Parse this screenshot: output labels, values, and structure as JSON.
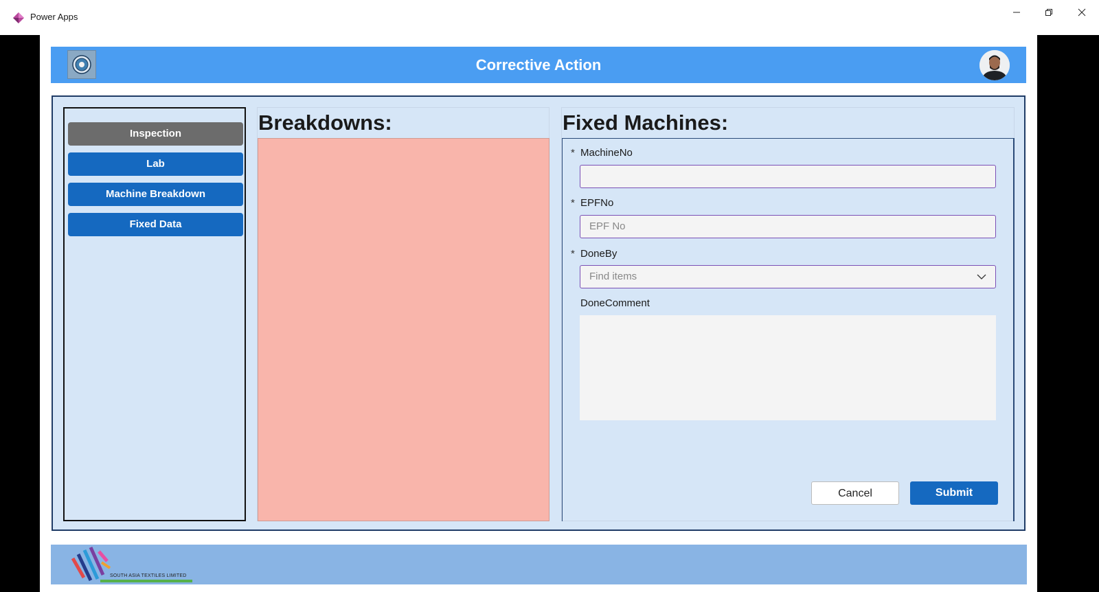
{
  "window": {
    "title": "Power Apps",
    "minimize_icon": "minimize-icon",
    "restore_icon": "restore-icon",
    "close_icon": "close-icon"
  },
  "header": {
    "title": "Corrective Action",
    "logo_icon": "company-seal-icon",
    "avatar_icon": "user-avatar"
  },
  "sidebar": {
    "items": [
      {
        "label": "Inspection",
        "active": true
      },
      {
        "label": "Lab",
        "active": false
      },
      {
        "label": "Machine Breakdown",
        "active": false
      },
      {
        "label": "Fixed Data",
        "active": false
      }
    ]
  },
  "breakdowns": {
    "title": "Breakdowns:"
  },
  "fixed_machines": {
    "title": "Fixed Machines:",
    "fields": {
      "machine_no": {
        "label": "MachineNo",
        "required": "*",
        "value": "",
        "placeholder": ""
      },
      "epf_no": {
        "label": "EPFNo",
        "required": "*",
        "value": "",
        "placeholder": "EPF No"
      },
      "done_by": {
        "label": "DoneBy",
        "required": "*",
        "placeholder": "Find items"
      },
      "done_comment": {
        "label": "DoneComment",
        "value": ""
      }
    },
    "cancel_label": "Cancel",
    "submit_label": "Submit"
  },
  "footer": {
    "company": "SOUTH ASIA TEXTILES LIMITED"
  },
  "colors": {
    "header_blue": "#4a9df2",
    "panel_bg": "#d6e6f7",
    "primary_button": "#1569c0",
    "active_nav": "#6c6c6c",
    "gallery_fill": "#f9b5ab",
    "footer_bg": "#89b4e4"
  }
}
